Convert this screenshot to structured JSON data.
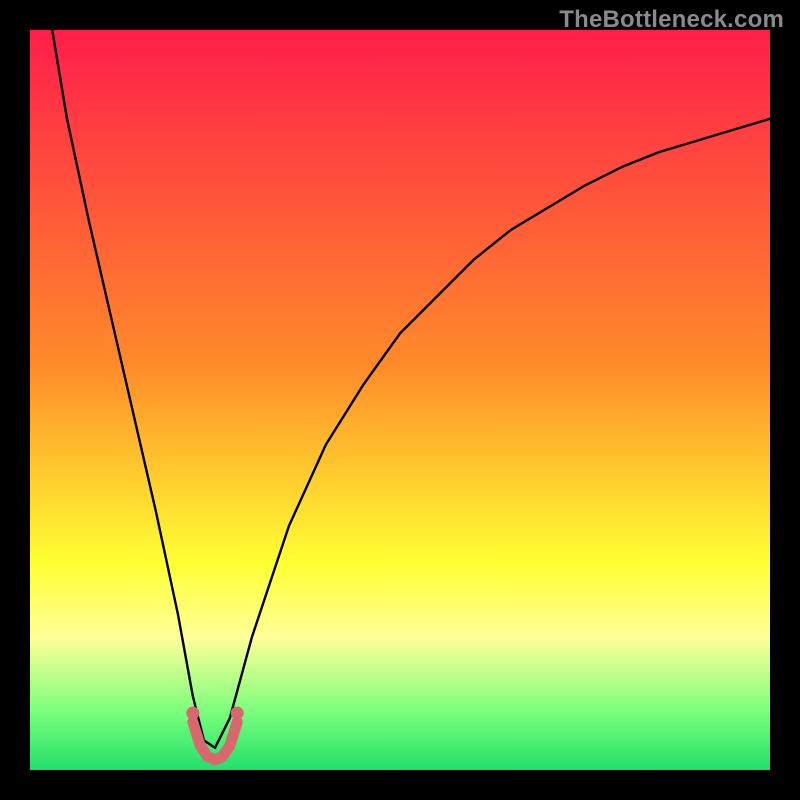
{
  "watermark": {
    "text": "TheBottleneck.com"
  },
  "colors": {
    "red": "#ff1e4b",
    "orange": "#ff8a2a",
    "yellow": "#ffff33",
    "paleYellow": "#ffff99",
    "lightGreen": "#7cff7c",
    "green": "#21df6b",
    "curve": "#000000",
    "marker": "#d9676e"
  },
  "chart_data": {
    "type": "line",
    "title": "",
    "xlabel": "",
    "ylabel": "",
    "xlim": [
      0,
      100
    ],
    "ylim": [
      0,
      100
    ],
    "grid": false,
    "legend": false,
    "series": [
      {
        "name": "bottleneck-curve",
        "x": [
          3,
          5,
          8,
          11,
          14,
          17,
          20,
          22,
          23.5,
          25,
          27,
          30,
          35,
          40,
          45,
          50,
          55,
          60,
          65,
          70,
          75,
          80,
          85,
          90,
          95,
          100
        ],
        "y": [
          100,
          88,
          74,
          61,
          48,
          35,
          21,
          10,
          4,
          3,
          7,
          18,
          33,
          44,
          52,
          59,
          64,
          69,
          73,
          76,
          79,
          81.5,
          83.5,
          85,
          86.5,
          88
        ]
      }
    ],
    "optimal_x": 25,
    "gradient_stops": [
      {
        "pct": 0,
        "color": "#ff1e4b"
      },
      {
        "pct": 45,
        "color": "#ff8a2a"
      },
      {
        "pct": 72,
        "color": "#ffff33"
      },
      {
        "pct": 82,
        "color": "#ffff99"
      },
      {
        "pct": 92,
        "color": "#7cff7c"
      },
      {
        "pct": 100,
        "color": "#21df6b"
      }
    ]
  }
}
